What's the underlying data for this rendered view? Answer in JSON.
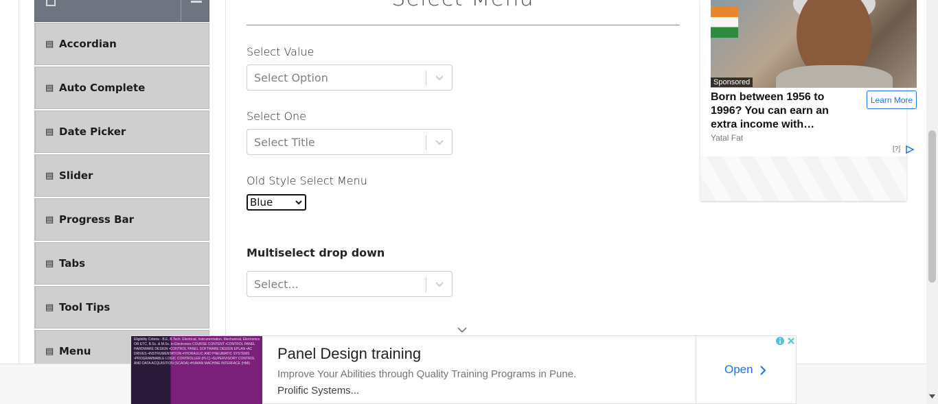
{
  "sidebar": {
    "items": [
      {
        "label": "Accordian",
        "icon": "html5-icon"
      },
      {
        "label": "Auto Complete",
        "icon": "html5-icon"
      },
      {
        "label": "Date Picker",
        "icon": "html5-icon"
      },
      {
        "label": "Slider",
        "icon": "html5-icon"
      },
      {
        "label": "Progress Bar",
        "icon": "html5-icon"
      },
      {
        "label": "Tabs",
        "icon": "html5-icon"
      },
      {
        "label": "Tool Tips",
        "icon": "html5-icon"
      },
      {
        "label": "Menu",
        "icon": "html5-icon"
      }
    ]
  },
  "main": {
    "title": "Select Menu",
    "select_value": {
      "label": "Select Value",
      "placeholder": "Select Option"
    },
    "select_one": {
      "label": "Select One",
      "placeholder": "Select Title"
    },
    "old_style": {
      "label": "Old Style Select Menu",
      "value": "Blue"
    },
    "multiselect": {
      "label": "Multiselect drop down",
      "placeholder": "Select..."
    }
  },
  "ad_right": {
    "sponsored": "Sponsored",
    "headline": "Born between 1956 to 1996? You can earn an extra income with…",
    "source": "Yatal Fat",
    "cta": "Learn More",
    "choices": "[?]"
  },
  "ad_bottom": {
    "title": "Panel Design training",
    "description": "Improve Your Abilities through Quality Training Programs in Pune.",
    "source": "Prolific Systems...",
    "cta": "Open",
    "image_text": "Eligibility Criteria - B.E, B.Tech. Electrical, Instrumentation, Mechanical, Electronics OR ETC, B.Sc. & M.Sc. in Electronics COURSE CONTENT •CONTROL PANEL HARDWARE DESIGN •CONTROL PANEL SOFTWARE DESIGN EPLAN •AC DRIVES •INSTRUMENTATION •HYDRAULIC AND PNEUMATIC SYSTEMS •PROGRAMMABLE LOGIC CONTROLLER (PLC) •SUPERVISORY CONTROL AND DATA ACQUISITION (SCADA) •HUMAN MACHINE INTERFACE (HMI)"
  }
}
